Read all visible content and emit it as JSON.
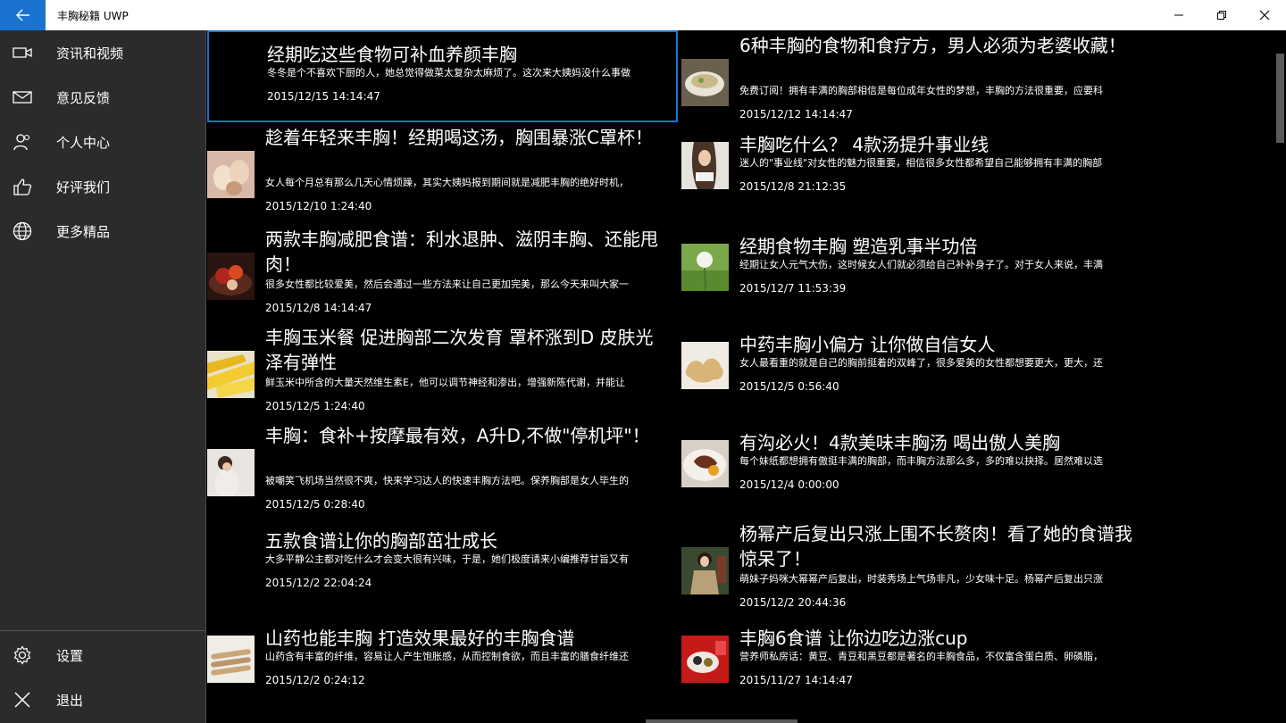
{
  "window": {
    "title": "丰胸秘籍 UWP"
  },
  "sidebar": {
    "items": [
      {
        "label": "资讯和视频",
        "icon": "video-camera-icon"
      },
      {
        "label": "意见反馈",
        "icon": "mail-icon"
      },
      {
        "label": "个人中心",
        "icon": "person-icon"
      },
      {
        "label": "好评我们",
        "icon": "thumbs-up-icon"
      },
      {
        "label": "更多精品",
        "icon": "globe-icon"
      }
    ],
    "bottom_items": [
      {
        "label": "设置",
        "icon": "gear-icon"
      },
      {
        "label": "退出",
        "icon": "close-icon"
      }
    ]
  },
  "articles": [
    {
      "title": "经期吃这些食物可补血养颜丰胸",
      "summary": "冬冬是个不喜欢下厨的人，她总觉得做菜太复杂太麻烦了。这次来大姨妈没什么事做",
      "date": "2015/12/15 14:14:47",
      "selected": true,
      "thumb": "none",
      "title_lines": 1
    },
    {
      "title": "6种丰胸的食物和食疗方，男人必须为老婆收藏！",
      "summary": "免费订阅！拥有丰满的胸部相信是每位成年女性的梦想，丰胸的方法很重要，应要科",
      "date": "2015/12/12 14:14:47",
      "thumb": "bowl",
      "title_lines": 2
    },
    {
      "title": "趁着年轻来丰胸！经期喝这汤，胸围暴涨C罩杯！",
      "summary": "女人每个月总有那么几天心情烦躁，其实大姨妈报到期间就是减肥丰胸的绝好时机，",
      "date": "2015/12/10 1:24:40",
      "thumb": "eggs",
      "title_lines": 2
    },
    {
      "title": "丰胸吃什么？ 4款汤提升事业线",
      "summary": "迷人的\"事业线\"对女性的魅力很重要，相信很多女性都希望自己能够拥有丰满的胸部",
      "date": "2015/12/8 21:12:35",
      "thumb": "woman",
      "title_lines": 1
    },
    {
      "title": "两款丰胸减肥食谱：利水退肿、滋阴丰胸、还能甩肉！",
      "summary": "很多女性都比较爱美，然后会通过一些方法来让自己更加完美，那么今天来叫大家一",
      "date": "2015/12/8 14:14:47",
      "thumb": "fruit",
      "title_lines": 2
    },
    {
      "title": "经期食物丰胸 塑造乳事半功倍",
      "summary": "经期让女人元气大伤，这时候女人们就必须给自己补补身子了。对于女人来说，丰满",
      "date": "2015/12/7 11:53:39",
      "thumb": "dandelion",
      "title_lines": 1
    },
    {
      "title": "丰胸玉米餐 促进胸部二次发育 罩杯涨到D 皮肤光泽有弹性",
      "summary": "鲜玉米中所含的大量天然维生素E，他可以调节神经和渗出，增强新陈代谢，并能让",
      "date": "2015/12/5 1:24:40",
      "thumb": "corn",
      "title_lines": 2
    },
    {
      "title": "中药丰胸小偏方 让你做自信女人",
      "summary": "女人最看重的就是自己的胸前挺着的双峰了，很多爱美的女性都想要更大，更大，还",
      "date": "2015/12/5 0:56:40",
      "thumb": "ginger",
      "title_lines": 1
    },
    {
      "title": "丰胸：食补+按摩最有效，A升D,不做\"停机坪\"！",
      "summary": "被嘲笑飞机场当然很不爽，快来学习达人的快速丰胸方法吧。保养胸部是女人毕生的",
      "date": "2015/12/5 0:28:40",
      "thumb": "woman2",
      "title_lines": 2
    },
    {
      "title": "有沟必火！4款美味丰胸汤 喝出傲人美胸",
      "summary": "每个妹纸都想拥有傲挺丰满的胸部，而丰胸方法那么多，多的难以抉择。居然难以选",
      "date": "2015/12/4 0:00:00",
      "thumb": "plate",
      "title_lines": 1
    },
    {
      "title": "五款食谱让你的胸部茁壮成长",
      "summary": "大多平静公主都对吃什么才会变大很有兴味，于是，她们极度请来小编推荐甘旨又有",
      "date": "2015/12/2 22:04:24",
      "thumb": "none",
      "title_lines": 1
    },
    {
      "title": "杨幂产后复出只涨上围不长赘肉！看了她的食谱我惊呆了！",
      "summary": "萌妹子妈咪大幂幂产后复出，时装秀场上气场非凡，少女味十足。杨幂产后复出只涨",
      "date": "2015/12/2 20:44:36",
      "thumb": "celebrity",
      "title_lines": 2
    },
    {
      "title": "山药也能丰胸 打造效果最好的丰胸食谱",
      "summary": "山药含有丰富的纤维，容易让人产生饱胀感，从而控制食欲，而且丰富的膳食纤维还",
      "date": "2015/12/2 0:24:12",
      "thumb": "yam",
      "title_lines": 1
    },
    {
      "title": "丰胸6食谱 让你边吃边涨cup",
      "summary": "营养师私房话：黄豆、青豆和黑豆都是著名的丰胸食品，不仅富含蛋白质、卵磷脂，",
      "date": "2015/11/27 14:14:47",
      "thumb": "red",
      "title_lines": 1
    }
  ],
  "colors": {
    "accent": "#1b73d0",
    "sidebar_bg": "#2b2b2b",
    "content_bg": "#000000",
    "titlebar_bg": "#ffffff"
  }
}
